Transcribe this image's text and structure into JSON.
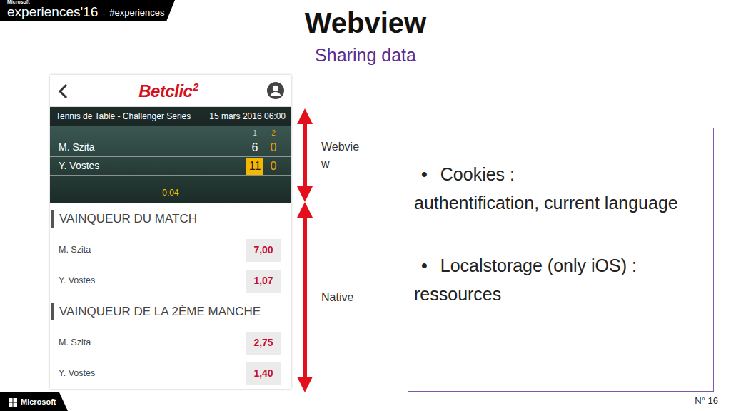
{
  "event": {
    "brand": "Microsoft",
    "name": "experiences'16",
    "separator": "-",
    "hashtag": "#experiences"
  },
  "slide": {
    "title": "Webview",
    "subtitle": "Sharing data",
    "number": "N° 16"
  },
  "app": {
    "logo": "Betclic",
    "logo_mark": "2",
    "match": {
      "competition": "Tennis de Table - Challenger Series",
      "date": "15 mars 2016 06:00",
      "set_headers": [
        "1",
        "2"
      ],
      "players": [
        {
          "name": "M. Szita",
          "scores": [
            {
              "value": "6",
              "highlighted": false
            },
            {
              "value": "0",
              "highlighted": false
            }
          ]
        },
        {
          "name": "Y. Vostes",
          "scores": [
            {
              "value": "11",
              "highlighted": true
            },
            {
              "value": "0",
              "highlighted": false
            }
          ]
        }
      ],
      "clock": "0:04"
    },
    "markets": [
      {
        "title": "VAINQUEUR DU MATCH",
        "outcomes": [
          {
            "name": "M. Szita",
            "odds": "7,00"
          },
          {
            "name": "Y. Vostes",
            "odds": "1,07"
          }
        ]
      },
      {
        "title": "VAINQUEUR DE LA 2ÈME MANCHE",
        "outcomes": [
          {
            "name": "M. Szita",
            "odds": "2,75"
          },
          {
            "name": "Y. Vostes",
            "odds": "1,40"
          }
        ]
      }
    ]
  },
  "segments": [
    {
      "label": "Webview"
    },
    {
      "label": "Native"
    }
  ],
  "notes": [
    {
      "marker": "•",
      "title": "Cookies :",
      "detail": "authentification, current language"
    },
    {
      "marker": "•",
      "title": "Localstorage (only iOS) :",
      "detail": "ressources"
    }
  ],
  "footer": {
    "brand": "Microsoft"
  }
}
